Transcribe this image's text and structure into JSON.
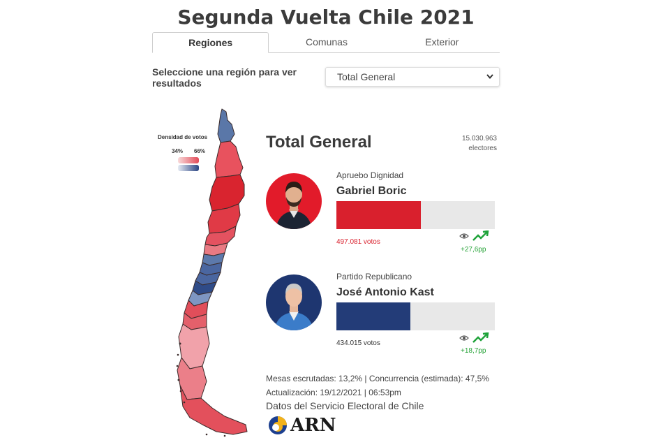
{
  "title": "Segunda Vuelta Chile 2021",
  "tabs": [
    {
      "label": "Regiones",
      "active": true
    },
    {
      "label": "Comunas",
      "active": false
    },
    {
      "label": "Exterior",
      "active": false
    }
  ],
  "selector": {
    "label": "Seleccione una región para ver resultados",
    "selected": "Total General",
    "chevron_icon": "chevron-down-icon"
  },
  "legend": {
    "title": "Densidad de votos",
    "low": "34%",
    "high": "66%",
    "colors": {
      "red": "#e24a58",
      "blue": "#2b4583"
    }
  },
  "results": {
    "title": "Total General",
    "electors_count": "15.030.963",
    "electors_label": "electores",
    "candidates": [
      {
        "party": "Apruebo Dignidad",
        "name": "Gabriel Boric",
        "votes": "497.081 votos",
        "share": 0.534,
        "color": "#d9202d",
        "eye_icon": "eye-icon",
        "trend_icon": "trending-up-icon",
        "trend": "+27,6pp"
      },
      {
        "party": "Partido Republicano",
        "name": "José Antonio Kast",
        "votes": "434.015 votos",
        "share": 0.466,
        "color": "#233c78",
        "eye_icon": "eye-icon",
        "trend_icon": "trending-up-icon",
        "trend": "+18,7pp"
      }
    ]
  },
  "footer": {
    "mesas": "Mesas escrutadas: 13,2% | Concurrencia (estimada): 47,5%",
    "updated": "Actualización: 19/12/2021 | 06:53pm",
    "source": "Datos del Servicio Electoral de Chile"
  },
  "logo": {
    "text": "ARN"
  }
}
